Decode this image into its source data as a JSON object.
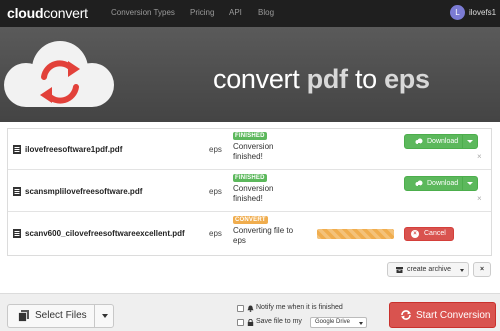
{
  "navbar": {
    "logo_bold": "cloud",
    "logo_light": "convert",
    "links": [
      "Conversion Types",
      "Pricing",
      "API",
      "Blog"
    ],
    "avatar_initial": "L",
    "user": "ilovefs1"
  },
  "hero": {
    "word1": "convert",
    "from_format": "pdf",
    "word2": "to",
    "to_format": "eps"
  },
  "files": [
    {
      "name": "ilovefreesoftware1pdf.pdf",
      "format": "eps",
      "badge": "FINISHED",
      "status": "Conversion finished!",
      "action": "Download"
    },
    {
      "name": "scansmplilovefreesoftware.pdf",
      "format": "eps",
      "badge": "FINISHED",
      "status": "Conversion finished!",
      "action": "Download"
    },
    {
      "name": "scanv600_cilovefreesoftwareexcellent.pdf",
      "format": "eps",
      "badge": "CONVERT",
      "status": "Converting file to eps",
      "action": "Cancel",
      "progress": 1.0
    }
  ],
  "archive": {
    "label": "create archive",
    "close": "×"
  },
  "footer": {
    "select_files": "Select Files",
    "notify_label": "Notify me when it is finished",
    "save_label": "Save file to my",
    "drive_option": "Google Drive",
    "start_label": "Start Conversion"
  },
  "icons": {
    "remove": "×",
    "cancel": "×"
  },
  "colors": {
    "navbar_bg": "#1f1f1f",
    "hero_bg": "#4f4f4f",
    "success": "#5cb85c",
    "warning": "#f0ad4e",
    "danger": "#d9534f",
    "footer_bg": "#efefef"
  }
}
